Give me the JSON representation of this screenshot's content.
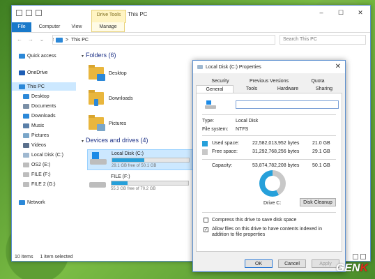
{
  "explorer": {
    "title": "This PC",
    "contextual_tab": "Drive Tools",
    "ribbon_tabs": [
      "File",
      "Computer",
      "View",
      "Manage"
    ],
    "window_controls": [
      "–",
      "☐",
      "✕"
    ],
    "path": "This PC",
    "path_sep": ">",
    "search_placeholder": "Search This PC",
    "nav": [
      "←",
      "→",
      "⌄",
      "↑"
    ]
  },
  "sidebar": {
    "items": [
      {
        "label": "Quick access",
        "icon": "star-icon",
        "color": "#2b88d8"
      },
      {
        "label": "OneDrive",
        "icon": "cloud-icon",
        "color": "#1e5eb5"
      },
      {
        "label": "This PC",
        "icon": "computer-icon",
        "color": "#2b88d8"
      },
      {
        "label": "Desktop",
        "icon": "desktop-icon",
        "color": "#2b88d8"
      },
      {
        "label": "Documents",
        "icon": "documents-icon",
        "color": "#7a8fa6"
      },
      {
        "label": "Downloads",
        "icon": "downloads-icon",
        "color": "#2b88d8"
      },
      {
        "label": "Music",
        "icon": "music-icon",
        "color": "#5a7fa8"
      },
      {
        "label": "Pictures",
        "icon": "pictures-icon",
        "color": "#7aa6c9"
      },
      {
        "label": "Videos",
        "icon": "videos-icon",
        "color": "#5a6f8c"
      },
      {
        "label": "Local Disk (C:)",
        "icon": "drive-icon",
        "color": "#9fb8d0"
      },
      {
        "label": "OS2 (E:)",
        "icon": "drive-icon",
        "color": "#bdbdbd"
      },
      {
        "label": "FILE (F:)",
        "icon": "drive-icon",
        "color": "#bdbdbd"
      },
      {
        "label": "FILE 2 (G:)",
        "icon": "drive-icon",
        "color": "#bdbdbd"
      },
      {
        "label": "Network",
        "icon": "network-icon",
        "color": "#2b88d8"
      }
    ]
  },
  "main": {
    "folders_header": "Folders (6)",
    "folders": [
      {
        "label": "Desktop",
        "overlay": "#2b88d8"
      },
      {
        "label": "Downloads",
        "overlay": "#2b88d8"
      },
      {
        "label": "Pictures",
        "overlay": "#7aa6c9"
      }
    ],
    "drives_header": "Devices and drives (4)",
    "drives": [
      {
        "label": "Local Disk (C:)",
        "free": "29.1 GB free of 50.1 GB",
        "used_fraction": 0.42
      },
      {
        "label": "FILE (F:)",
        "free": "55.3 GB free of 70.2 GB",
        "used_fraction": 0.21
      }
    ]
  },
  "status": {
    "items": "10 items",
    "selected": "1 item selected"
  },
  "dialog": {
    "title": "Local Disk (C:) Properties",
    "close": "✕",
    "tabs_top": [
      "Security",
      "Previous Versions",
      "Quota"
    ],
    "tabs_bottom": [
      "General",
      "Tools",
      "Hardware",
      "Sharing"
    ],
    "active_tab": "General",
    "name_value": "",
    "type_label": "Type:",
    "type_value": "Local Disk",
    "fs_label": "File system:",
    "fs_value": "NTFS",
    "used_label": "Used space:",
    "used_bytes": "22,582,013,952 bytes",
    "used_gb": "21.0 GB",
    "used_color": "#26a0da",
    "free_label": "Free space:",
    "free_bytes": "31,292,768,256 bytes",
    "free_gb": "29.1 GB",
    "free_color": "#c8c8c8",
    "capacity_label": "Capacity:",
    "capacity_bytes": "53,874,782,208 bytes",
    "capacity_gb": "50.1 GB",
    "drive_label": "Drive C:",
    "cleanup": "Disk Cleanup",
    "compress": "Compress this drive to save disk space",
    "index": "Allow files on this drive to have contents indexed in addition to file properties",
    "compress_checked": false,
    "index_checked": true,
    "ok": "OK",
    "cancel": "Cancel",
    "apply": "Apply"
  },
  "watermark": {
    "prefix": "GEN",
    "suffix": "K"
  }
}
